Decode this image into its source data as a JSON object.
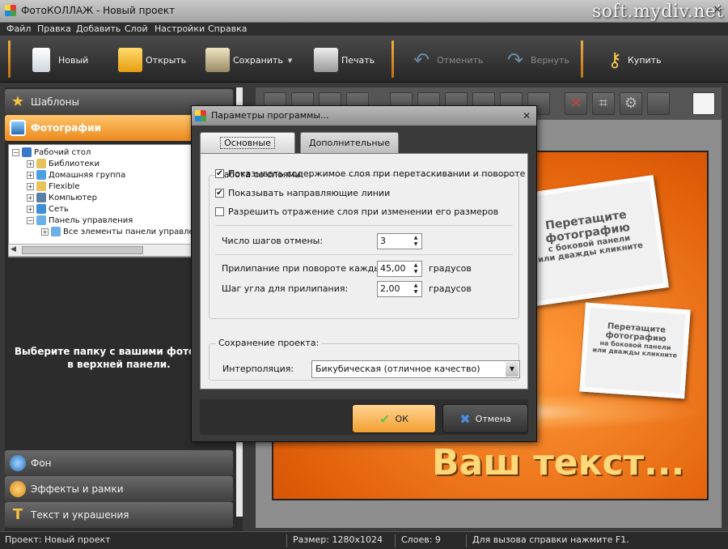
{
  "window": {
    "title": "ФотоКОЛЛАЖ - Новый проект",
    "watermark": "soft.mydiv.net"
  },
  "menu": [
    "Файл",
    "Правка",
    "Добавить",
    "Слой",
    "Настройки",
    "Справка"
  ],
  "toolbar": {
    "new": "Новый",
    "open": "Открыть",
    "save": "Сохранить",
    "print": "Печать",
    "undo": "Отменить",
    "redo": "Вернуть",
    "buy": "Купить"
  },
  "sidebar": {
    "templates": "Шаблоны",
    "photos": "Фотографии",
    "tree": [
      "Рабочий стол",
      "Библиотеки",
      "Домашняя группа",
      "Flexible",
      "Компьютер",
      "Сеть",
      "Панель управления",
      "Все элементы панели управления"
    ],
    "hint_line1": "Выберите папку с вашими фотограф",
    "hint_line2": "в верхней панели.",
    "background": "Фон",
    "effects": "Эффекты и рамки",
    "text": "Текст и украшения"
  },
  "collage": {
    "frame1_line1": "Перетащите",
    "frame1_line2": "фотографию",
    "frame1_line3": "с боковой панели",
    "frame1_line4": "или дважды кликните",
    "frame2_line1": "Перетащите",
    "frame2_line2": "фотографию",
    "frame2_line3": "на боковой панели",
    "frame2_line4": "или дважды кликните",
    "caption": "Ваш текст..."
  },
  "dialog": {
    "title": "Параметры программы...",
    "tab_main": "Основные",
    "tab_extra": "Дополнительные",
    "layers_group": "Работа со слоями:",
    "chk_show_content": "Показывать содержимое слоя при перетаскивании и повороте",
    "chk_show_guides": "Показывать направляющие линии",
    "chk_allow_mirror": "Разрешить отражение слоя при изменении его размеров",
    "checks": [
      true,
      true,
      false
    ],
    "undo_steps_label": "Число шагов отмены:",
    "undo_steps": "3",
    "snap_rotate_label": "Прилипание при повороте каждые:",
    "snap_rotate": "45,00",
    "snap_step_label": "Шаг угла для прилипания:",
    "snap_step": "2,00",
    "degrees": "градусов",
    "save_group": "Сохранение проекта:",
    "interp_label": "Интерполяция:",
    "interp_value": "Бикубическая (отличное качество)",
    "ok": "ОК",
    "cancel": "Отмена"
  },
  "status": {
    "project": "Проект: Новый проект",
    "size": "Размер: 1280x1024",
    "layers": "Слоев: 9",
    "help": "Для вызова справки нажмите F1."
  },
  "colors": {
    "accent": "#f3a030",
    "canvas_orange": "#e2600a"
  }
}
